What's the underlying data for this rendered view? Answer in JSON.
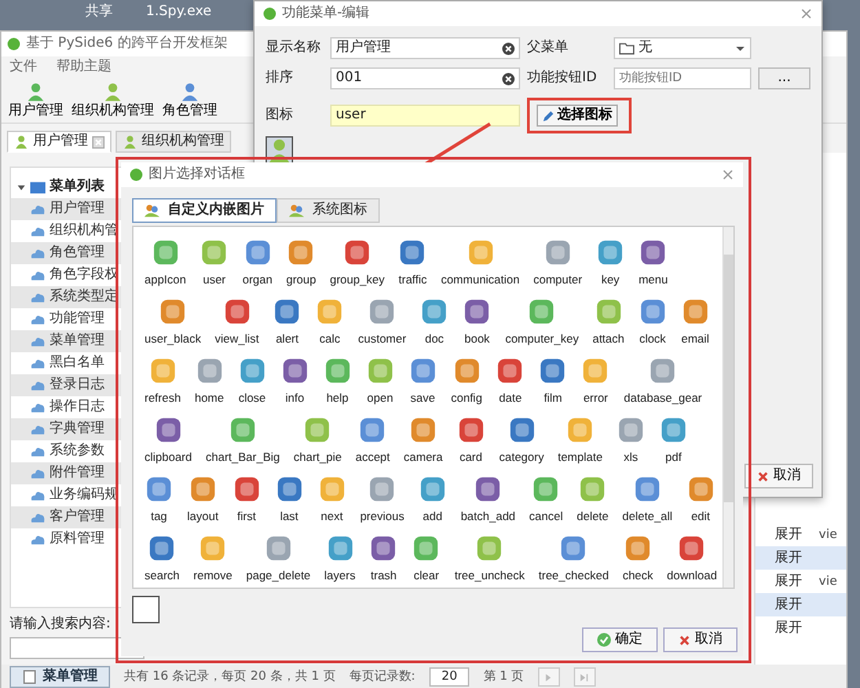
{
  "desktop": {
    "taskbar_items": [
      "共享",
      "1.Spy.exe"
    ]
  },
  "main_window": {
    "title": "基于 PySide6 的跨平台开发框架",
    "menu": [
      "文件",
      "帮助主题"
    ],
    "toolbar": [
      {
        "label": "用户管理"
      },
      {
        "label": "组织机构管理"
      },
      {
        "label": "角色管理"
      }
    ],
    "tabs": [
      {
        "label": "用户管理",
        "selected": true
      },
      {
        "label": "组织机构管理",
        "selected": false
      }
    ],
    "tree": {
      "label": "菜单列表",
      "expanded": true,
      "children": [
        {
          "label": "用户管理"
        },
        {
          "label": "组织机构管"
        },
        {
          "label": "角色管理"
        },
        {
          "label": "角色字段权"
        },
        {
          "label": "系统类型定"
        },
        {
          "label": "功能管理"
        },
        {
          "label": "菜单管理"
        },
        {
          "label": "黑白名单"
        },
        {
          "label": "登录日志"
        },
        {
          "label": "操作日志"
        },
        {
          "label": "字典管理"
        },
        {
          "label": "系统参数"
        },
        {
          "label": "附件管理"
        },
        {
          "label": "业务编码规"
        },
        {
          "label": "客户管理"
        },
        {
          "label": "原料管理"
        }
      ]
    },
    "search": {
      "label": "请输入搜索内容:"
    },
    "table": {
      "rows": [
        {
          "column_1": "展开",
          "column_2": "vie"
        },
        {
          "column_1": "展开"
        },
        {
          "column_1": "展开",
          "column_2": "vie"
        },
        {
          "column_1": "展开"
        },
        {
          "column_1": "展开"
        }
      ]
    },
    "pagination": {
      "summary": "共有 16 条记录，每页 20 条，共 1 页",
      "page_size_label": "每页记录数:",
      "page_size": "20",
      "page": "第 1 页"
    },
    "bottom_tab": "菜单管理"
  },
  "edit_dialog": {
    "title": "功能菜单-编辑",
    "display_name": {
      "label": "显示名称",
      "value": "用户管理"
    },
    "parent_menu": {
      "label": "父菜单",
      "value": "无"
    },
    "order": {
      "label": "排序",
      "value": "001"
    },
    "button_id": {
      "label": "功能按钮ID",
      "placeholder": "功能按钮ID",
      "button": "..."
    },
    "icon": {
      "label": "图标",
      "value": "user",
      "button": "选择图标"
    },
    "cancel_button": "取消"
  },
  "icon_dialog": {
    "title": "图片选择对话框",
    "tabs": [
      {
        "label": "自定义内嵌图片",
        "selected": true
      },
      {
        "label": "系统图标",
        "selected": false
      }
    ],
    "icon_rows": [
      [
        "appIcon",
        "user",
        "organ",
        "group",
        "group_key",
        "traffic",
        "communication",
        "computer",
        "key",
        "menu"
      ],
      [
        "user_black",
        "view_list",
        "alert",
        "calc",
        "customer",
        "doc",
        "book",
        "computer_key",
        "attach",
        "clock",
        "email"
      ],
      [
        "refresh",
        "home",
        "close",
        "info",
        "help",
        "open",
        "save",
        "config",
        "date",
        "film",
        "error",
        "database_gear"
      ],
      [
        "clipboard",
        "chart_Bar_Big",
        "chart_pie",
        "accept",
        "camera",
        "card",
        "category",
        "template",
        "xls",
        "pdf"
      ],
      [
        "tag",
        "layout",
        "first",
        "last",
        "next",
        "previous",
        "add",
        "batch_add",
        "cancel",
        "delete",
        "delete_all",
        "edit"
      ],
      [
        "search",
        "remove",
        "page_delete",
        "layers",
        "trash",
        "clear",
        "tree_uncheck",
        "tree_checked",
        "check",
        "download"
      ]
    ],
    "ok_button": "确定",
    "cancel_button": "取消"
  }
}
